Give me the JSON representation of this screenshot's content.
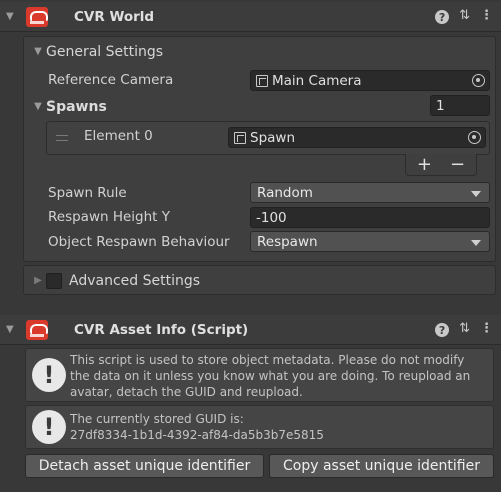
{
  "components": {
    "cvr_world": {
      "title": "CVR World",
      "icon": "cvr-logo-icon",
      "header_icons": [
        "help-icon",
        "preset-sliders-icon",
        "more-menu-icon"
      ],
      "general_settings": {
        "label": "General Settings",
        "reference_camera": {
          "label": "Reference Camera",
          "value": "Main Camera"
        },
        "spawns": {
          "label": "Spawns",
          "count": "1",
          "elements": [
            {
              "label": "Element 0",
              "value": "Spawn"
            }
          ],
          "add_label": "+",
          "remove_label": "−"
        },
        "spawn_rule": {
          "label": "Spawn Rule",
          "value": "Random"
        },
        "respawn_height": {
          "label": "Respawn Height Y",
          "value": "-100"
        },
        "object_respawn": {
          "label": "Object Respawn Behaviour",
          "value": "Respawn"
        }
      },
      "advanced_settings": {
        "label": "Advanced Settings",
        "checked": false
      }
    },
    "asset_info": {
      "title": "CVR Asset Info (Script)",
      "icon": "cvr-logo-icon",
      "info_message": "This script is used to store object metadata. Please do not modify the data on it unless you know what you are doing. To reupload an avatar, detach the GUID and reupload.",
      "guid_label": "The currently stored GUID is:",
      "guid_value": "27df8334-1b1d-4392-af84-da5b3b7e5815",
      "detach_button": "Detach asset unique identifier",
      "copy_button": "Copy asset unique identifier"
    }
  },
  "colors": {
    "background": "#383838",
    "logo": "#d93a2b",
    "field": "#2a2a2a",
    "dropdown": "#515151"
  }
}
